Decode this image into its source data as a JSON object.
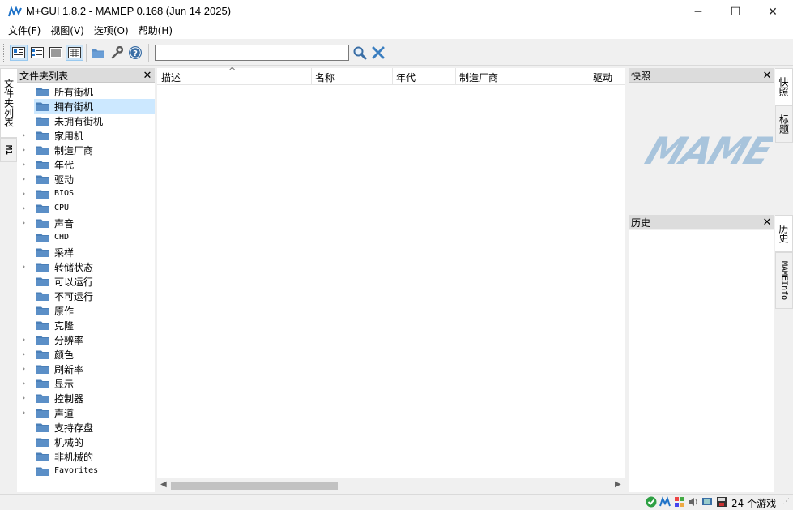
{
  "window": {
    "title": "M+GUI 1.8.2 - MAMEP 0.168 (Jun 14 2025)",
    "minimize": "─",
    "maximize": "☐",
    "close": "✕"
  },
  "menu": [
    "文件(F)",
    "视图(V)",
    "选项(O)",
    "帮助(H)"
  ],
  "search": {
    "value": "",
    "placeholder": ""
  },
  "left_tabs": [
    "文件夹列表",
    "M1"
  ],
  "folder_panel": {
    "title": "文件夹列表",
    "close": "✕",
    "items": [
      {
        "label": "所有街机",
        "expandable": false,
        "selected": false,
        "mono": false
      },
      {
        "label": "拥有街机",
        "expandable": false,
        "selected": true,
        "mono": false
      },
      {
        "label": "未拥有街机",
        "expandable": false,
        "selected": false,
        "mono": false
      },
      {
        "label": "家用机",
        "expandable": true,
        "selected": false,
        "mono": false
      },
      {
        "label": "制造厂商",
        "expandable": true,
        "selected": false,
        "mono": false
      },
      {
        "label": "年代",
        "expandable": true,
        "selected": false,
        "mono": false
      },
      {
        "label": "驱动",
        "expandable": true,
        "selected": false,
        "mono": false
      },
      {
        "label": "BIOS",
        "expandable": true,
        "selected": false,
        "mono": true
      },
      {
        "label": "CPU",
        "expandable": true,
        "selected": false,
        "mono": true
      },
      {
        "label": "声音",
        "expandable": true,
        "selected": false,
        "mono": false
      },
      {
        "label": "CHD",
        "expandable": false,
        "selected": false,
        "mono": true
      },
      {
        "label": "采样",
        "expandable": false,
        "selected": false,
        "mono": false
      },
      {
        "label": "转储状态",
        "expandable": true,
        "selected": false,
        "mono": false
      },
      {
        "label": "可以运行",
        "expandable": false,
        "selected": false,
        "mono": false
      },
      {
        "label": "不可运行",
        "expandable": false,
        "selected": false,
        "mono": false
      },
      {
        "label": "原作",
        "expandable": false,
        "selected": false,
        "mono": false
      },
      {
        "label": "克隆",
        "expandable": false,
        "selected": false,
        "mono": false
      },
      {
        "label": "分辨率",
        "expandable": true,
        "selected": false,
        "mono": false
      },
      {
        "label": "颜色",
        "expandable": true,
        "selected": false,
        "mono": false
      },
      {
        "label": "刷新率",
        "expandable": true,
        "selected": false,
        "mono": false
      },
      {
        "label": "显示",
        "expandable": true,
        "selected": false,
        "mono": false
      },
      {
        "label": "控制器",
        "expandable": true,
        "selected": false,
        "mono": false
      },
      {
        "label": "声道",
        "expandable": true,
        "selected": false,
        "mono": false
      },
      {
        "label": "支持存盘",
        "expandable": false,
        "selected": false,
        "mono": false
      },
      {
        "label": "机械的",
        "expandable": false,
        "selected": false,
        "mono": false
      },
      {
        "label": "非机械的",
        "expandable": false,
        "selected": false,
        "mono": false
      },
      {
        "label": "Favorites",
        "expandable": false,
        "selected": false,
        "mono": true
      }
    ]
  },
  "game_list": {
    "columns": [
      "描述",
      "名称",
      "年代",
      "制造厂商",
      "驱动"
    ],
    "sort_indicator": "^"
  },
  "snapshot_panel": {
    "title": "快照",
    "close": "✕",
    "logo_text": "MAME"
  },
  "history_panel": {
    "title": "历史",
    "close": "✕"
  },
  "right_tabs_top": [
    "快照",
    "标题"
  ],
  "right_tabs_bottom": [
    "历史",
    "MAMEInfo"
  ],
  "status": {
    "count": "24 个游戏"
  },
  "colors": {
    "selection": "#cce8ff",
    "folder": "#5b8fc7",
    "logo": "#a8c4dc",
    "accent": "#1e72c8"
  }
}
